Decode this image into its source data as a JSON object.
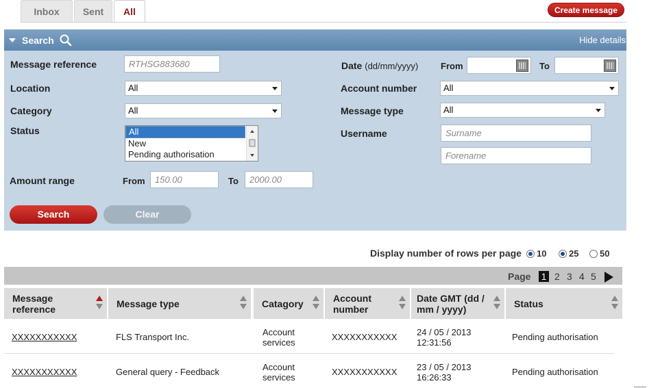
{
  "tabs": [
    "Inbox",
    "Sent",
    "All"
  ],
  "create_message": "Create message",
  "search_panel": {
    "title": "Search",
    "hide_details": "Hide details",
    "message_reference": {
      "label": "Message reference",
      "placeholder": "RTHSG883680"
    },
    "location": {
      "label": "Location",
      "value": "All"
    },
    "category": {
      "label": "Category",
      "value": "All"
    },
    "status": {
      "label": "Status",
      "options": [
        "All",
        "New",
        "Pending authorisation"
      ]
    },
    "amount_range": {
      "label": "Amount range",
      "from_label": "From",
      "from_placeholder": "150.00",
      "to_label": "To",
      "to_placeholder": "2000.00"
    },
    "date": {
      "label": "Date",
      "format": "(dd/mm/yyyy)",
      "from_label": "From",
      "to_label": "To"
    },
    "account_number": {
      "label": "Account number",
      "value": "All"
    },
    "message_type": {
      "label": "Message type",
      "value": "All"
    },
    "username": {
      "label": "Username",
      "surname_placeholder": "Surname",
      "forename_placeholder": "Forename"
    },
    "search_button": "Search",
    "clear_button": "Clear"
  },
  "rows_per_page": {
    "label": "Display number of rows per page",
    "options": [
      "10",
      "25",
      "50"
    ]
  },
  "pagination": {
    "label": "Page",
    "pages": [
      "1",
      "2",
      "3",
      "4",
      "5"
    ],
    "current": "1"
  },
  "table": {
    "headers": [
      "Message reference",
      "Message type",
      "Catagory",
      "Account number",
      "Date GMT (dd / mm / yyyy)",
      "Status"
    ],
    "rows": [
      {
        "ref": "XXXXXXXXXXX",
        "type": "FLS Transport Inc.",
        "category": "Account services",
        "account": "XXXXXXXXXXX",
        "date": "24 / 05 / 2013",
        "time": "12:31:56",
        "status": "Pending authorisation"
      },
      {
        "ref": "XXXXXXXXXXX",
        "type": "General query - Feedback",
        "category": "Account services",
        "account": "XXXXXXXXXXX",
        "date": "23 / 05 / 2013",
        "time": "16:26:33",
        "status": "Pending authorisation"
      }
    ]
  }
}
